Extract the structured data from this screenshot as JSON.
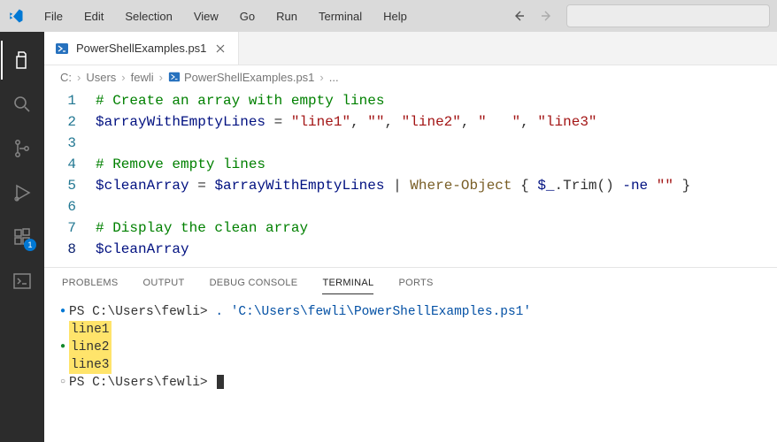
{
  "menu": {
    "items": [
      "File",
      "Edit",
      "Selection",
      "View",
      "Go",
      "Run",
      "Terminal",
      "Help"
    ]
  },
  "activitybar": {
    "extensions_badge": "1"
  },
  "tab": {
    "label": "PowerShellExamples.ps1"
  },
  "breadcrumb": {
    "c": "C:",
    "users": "Users",
    "user": "fewli",
    "file": "PowerShellExamples.ps1",
    "ellipsis": "..."
  },
  "code": {
    "l1": {
      "n": "1",
      "comment": "# Create an array with empty lines"
    },
    "l2": {
      "n": "2",
      "var": "$arrayWithEmptyLines",
      "s1": "\"line1\"",
      "s2": "\"\"",
      "s3": "\"line2\"",
      "s4": "\"   \"",
      "s5": "\"line3\""
    },
    "l3": {
      "n": "3"
    },
    "l4": {
      "n": "4",
      "comment": "# Remove empty lines"
    },
    "l5": {
      "n": "5",
      "v1": "$cleanArray",
      "v2": "$arrayWithEmptyLines",
      "cmd": "Where-Object",
      "v3": "$_",
      "method": ".Trim()",
      "ne": "-ne",
      "empty": "\"\""
    },
    "l6": {
      "n": "6"
    },
    "l7": {
      "n": "7",
      "comment": "# Display the clean array"
    },
    "l8": {
      "n": "8",
      "var": "$cleanArray"
    }
  },
  "panel": {
    "tabs": {
      "problems": "Problems",
      "output": "Output",
      "debug": "Debug Console",
      "terminal": "Terminal",
      "ports": "Ports"
    }
  },
  "terminal": {
    "line1_prompt": "PS C:\\Users\\fewli> ",
    "line1_cmd": ". 'C:\\Users\\fewli\\PowerShellExamples.ps1'",
    "out1": "line1",
    "out2": "line2",
    "out3": "line3",
    "line2_prompt": "PS C:\\Users\\fewli> "
  }
}
